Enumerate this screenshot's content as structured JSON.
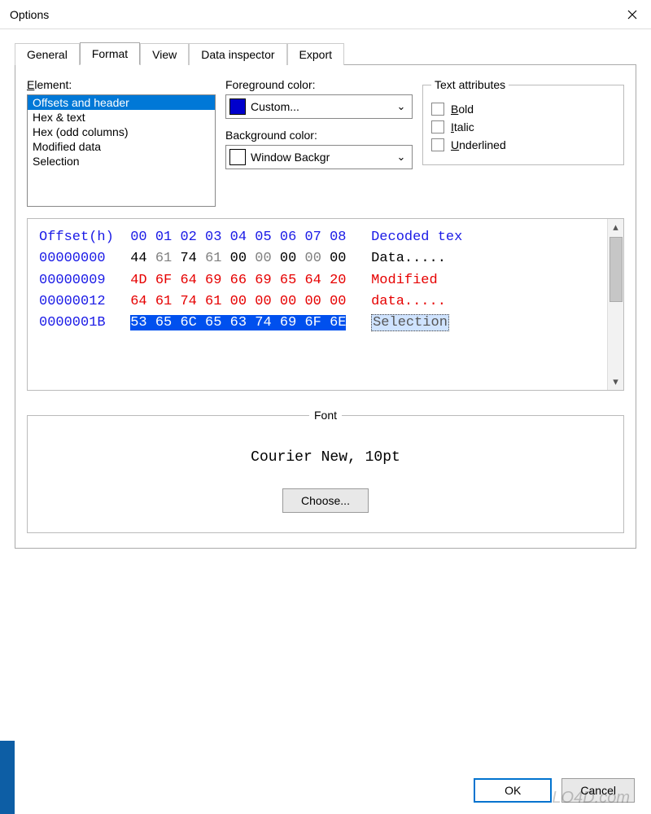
{
  "window": {
    "title": "Options"
  },
  "tabs": [
    "General",
    "Format",
    "View",
    "Data inspector",
    "Export"
  ],
  "active_tab": "Format",
  "element_label": "Element:",
  "elements": [
    "Offsets and header",
    "Hex & text",
    "Hex (odd columns)",
    "Modified data",
    "Selection"
  ],
  "selected_element": "Offsets and header",
  "fg_label": "Foreground color:",
  "fg_value": "Custom...",
  "fg_swatch": "#0000cc",
  "bg_label": "Background color:",
  "bg_value": "Window Backgr",
  "bg_swatch": "#ffffff",
  "attrs_legend": "Text attributes",
  "attrs": {
    "bold": "Bold",
    "italic": "Italic",
    "underlined": "Underlined"
  },
  "preview": {
    "header_offset": "Offset(h)",
    "header_cols": [
      "00",
      "01",
      "02",
      "03",
      "04",
      "05",
      "06",
      "07",
      "08"
    ],
    "header_decoded": "Decoded tex",
    "rows": [
      {
        "off": "00000000",
        "hex": [
          "44",
          "61",
          "74",
          "61",
          "00",
          "00",
          "00",
          "00",
          "00"
        ],
        "dec": "Data.....",
        "style": "normal"
      },
      {
        "off": "00000009",
        "hex": [
          "4D",
          "6F",
          "64",
          "69",
          "66",
          "69",
          "65",
          "64",
          "20"
        ],
        "dec": "Modified ",
        "style": "modified"
      },
      {
        "off": "00000012",
        "hex": [
          "64",
          "61",
          "74",
          "61",
          "00",
          "00",
          "00",
          "00",
          "00"
        ],
        "dec": "data.....",
        "style": "modified"
      },
      {
        "off": "0000001B",
        "hex": [
          "53",
          "65",
          "6C",
          "65",
          "63",
          "74",
          "69",
          "6F",
          "6E"
        ],
        "dec": "Selection",
        "style": "selection"
      }
    ]
  },
  "font_legend": "Font",
  "font_sample": "Courier New, 10pt",
  "choose_label": "Choose...",
  "ok_label": "OK",
  "cancel_label": "Cancel",
  "watermark": "LO4D.com"
}
